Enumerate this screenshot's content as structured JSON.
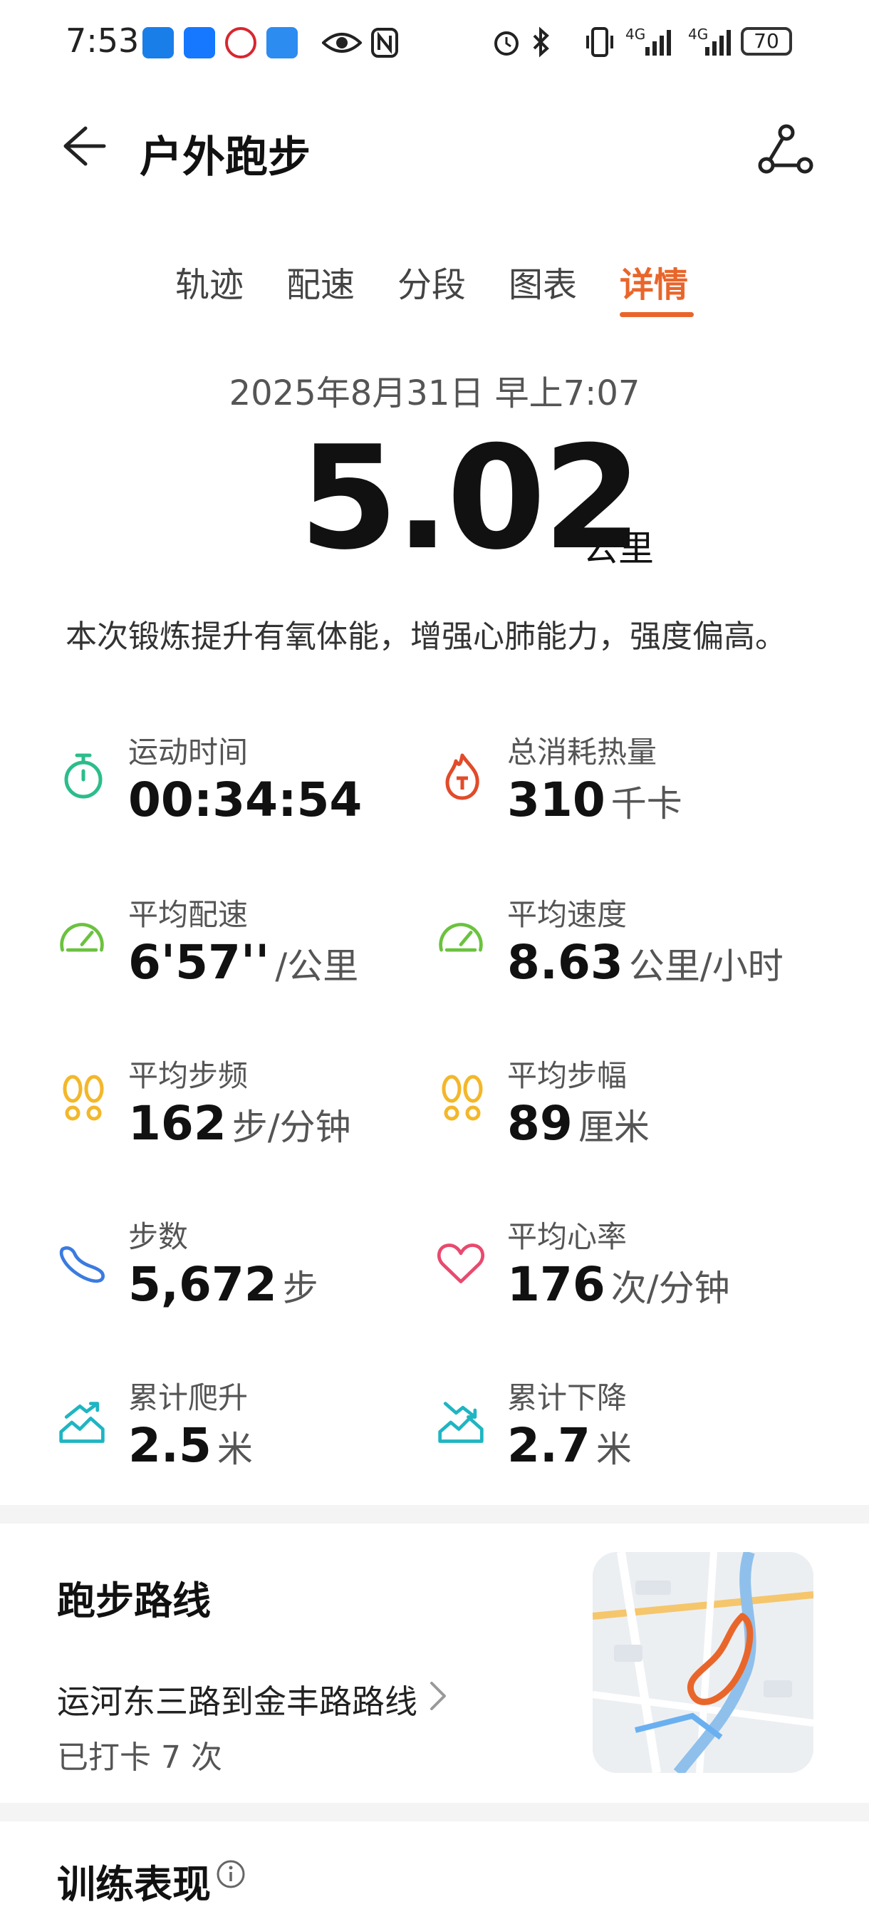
{
  "status_bar": {
    "time": "7:53",
    "signal_1": "4G",
    "signal_2": "4G",
    "battery": "70",
    "icons": [
      "app-icon-blue",
      "alipay-icon",
      "metro-icon",
      "weather-icon",
      "eye-icon",
      "nfc-icon",
      "alarm-icon",
      "bluetooth-icon",
      "vibrate-icon"
    ]
  },
  "header": {
    "title": "户外跑步",
    "back_icon": "back-arrow-icon",
    "action_icon": "route-share-icon"
  },
  "tabs": [
    {
      "label": "轨迹",
      "active": false
    },
    {
      "label": "配速",
      "active": false
    },
    {
      "label": "分段",
      "active": false
    },
    {
      "label": "图表",
      "active": false
    },
    {
      "label": "详情",
      "active": true
    }
  ],
  "summary": {
    "date": "2025年8月31日 早上7:07",
    "distance": "5.02",
    "distance_unit": "公里",
    "description": "本次锻炼提升有氧体能，增强心肺能力，强度偏高。"
  },
  "metrics": [
    {
      "label": "运动时间",
      "value": "00:34:54",
      "unit": "",
      "icon": "stopwatch-icon",
      "color": "#2bbd8a"
    },
    {
      "label": "总消耗热量",
      "value": "310",
      "unit": "千卡",
      "icon": "flame-icon",
      "color": "#e24b2a"
    },
    {
      "label": "平均配速",
      "value": "6'57''",
      "unit": "/公里",
      "icon": "speedometer-icon",
      "color": "#6bc23e"
    },
    {
      "label": "平均速度",
      "value": "8.63",
      "unit": "公里/小时",
      "icon": "speedometer-icon",
      "color": "#6bc23e"
    },
    {
      "label": "平均步频",
      "value": "162",
      "unit": "步/分钟",
      "icon": "footprints-icon",
      "color": "#f3b72a"
    },
    {
      "label": "平均步幅",
      "value": "89",
      "unit": "厘米",
      "icon": "footprints-icon",
      "color": "#f3b72a"
    },
    {
      "label": "步数",
      "value": "5,672",
      "unit": "步",
      "icon": "shoe-icon",
      "color": "#3a7be0"
    },
    {
      "label": "平均心率",
      "value": "176",
      "unit": "次/分钟",
      "icon": "heart-icon",
      "color": "#e84a6e"
    },
    {
      "label": "累计爬升",
      "value": "2.5",
      "unit": "米",
      "icon": "climb-icon",
      "color": "#1fb5c2"
    },
    {
      "label": "累计下降",
      "value": "2.7",
      "unit": "米",
      "icon": "descent-icon",
      "color": "#1fb5c2"
    }
  ],
  "route": {
    "title": "跑步路线",
    "name": "运河东三路到金丰路路线",
    "count": "已打卡 7 次"
  },
  "training": {
    "title": "训练表现"
  },
  "colors": {
    "accent": "#e9662b",
    "band": "#f4f4f4"
  }
}
